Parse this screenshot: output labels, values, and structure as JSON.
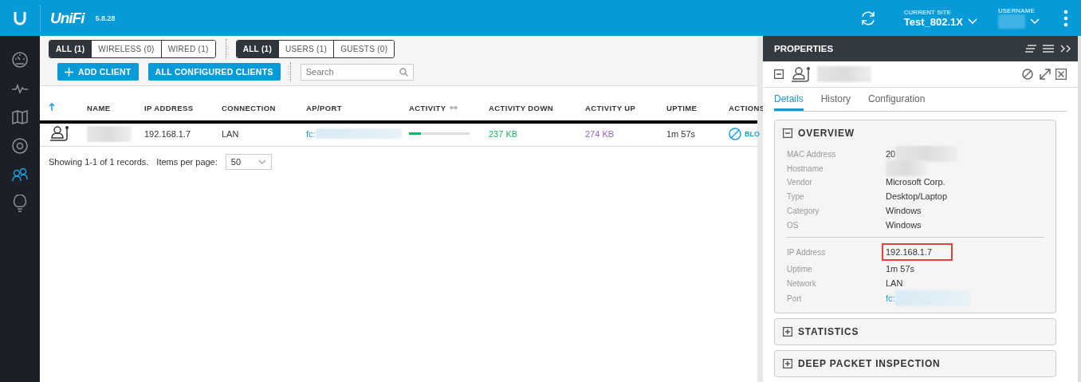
{
  "header": {
    "logo_text": "UniFi",
    "version": "5.8.28",
    "site_label": "CURRENT SITE",
    "site": "Test_802.1X",
    "user_label": "USERNAME"
  },
  "sidebar": {
    "items": [
      {
        "kind": "dashboard",
        "selected": false
      },
      {
        "kind": "statistics",
        "selected": false
      },
      {
        "kind": "map",
        "selected": false
      },
      {
        "kind": "devices",
        "selected": false
      },
      {
        "kind": "clients",
        "selected": true
      },
      {
        "kind": "insights",
        "selected": false
      }
    ]
  },
  "filters": {
    "connection": [
      {
        "label": "ALL (1)",
        "selected": true
      },
      {
        "label": "WIRELESS (0)",
        "selected": false
      },
      {
        "label": "WIRED (1)",
        "selected": false
      }
    ],
    "type": [
      {
        "label": "ALL (1)",
        "selected": true
      },
      {
        "label": "USERS (1)",
        "selected": false
      },
      {
        "label": "GUESTS (0)",
        "selected": false
      }
    ]
  },
  "buttons": [
    {
      "label": "ADD CLIENT",
      "kind": "add"
    },
    {
      "label": "ALL CONFIGURED CLIENTS",
      "kind": "plain"
    }
  ],
  "search": {
    "placeholder": "Search"
  },
  "table": {
    "columns": [
      "NAME",
      "IP ADDRESS",
      "CONNECTION",
      "AP/PORT",
      "ACTIVITY",
      "ACTIVITY DOWN",
      "ACTIVITY UP",
      "UPTIME",
      "ACTIONS"
    ],
    "rows": [
      {
        "ip": "192.168.1.7",
        "connection": "LAN",
        "ap_port": "fc:",
        "level": 0.2,
        "down": "237 KB",
        "up": "274 KB",
        "uptime": "1m 57s",
        "action": "BLO"
      }
    ]
  },
  "pager": {
    "summary": "Showing 1-1 of 1 records.",
    "per_page_label": "Items per page:",
    "per_page": "50"
  },
  "properties": {
    "title": "PROPERTIES",
    "tabs": [
      {
        "label": "Details",
        "selected": true
      },
      {
        "label": "History",
        "selected": false
      },
      {
        "label": "Configuration",
        "selected": false
      }
    ],
    "sections": [
      {
        "title": "OVERVIEW",
        "expanded": true,
        "groups": [
          [
            {
              "label": "MAC Address",
              "value": "20",
              "kind": "text",
              "blurred": true,
              "highlighted": false
            },
            {
              "label": "Hostname",
              "kind": "text",
              "blurred": true,
              "highlighted": false
            },
            {
              "label": "Vendor",
              "value": "Microsoft Corp.",
              "kind": "text",
              "blurred": false,
              "highlighted": false
            },
            {
              "label": "Type",
              "value": "Desktop/Laptop",
              "kind": "text",
              "blurred": false,
              "highlighted": false
            },
            {
              "label": "Category",
              "value": "Windows",
              "kind": "text",
              "blurred": false,
              "highlighted": false
            },
            {
              "label": "OS",
              "value": "Windows",
              "kind": "text",
              "blurred": false,
              "highlighted": false
            }
          ],
          [
            {
              "label": "IP Address",
              "value": "192.168.1.7",
              "kind": "text",
              "blurred": false,
              "highlighted": true
            },
            {
              "label": "Uptime",
              "value": "1m 57s",
              "kind": "text",
              "blurred": false,
              "highlighted": false
            },
            {
              "label": "Network",
              "value": "LAN",
              "kind": "text",
              "blurred": false,
              "highlighted": false
            },
            {
              "label": "Port",
              "value": "fc:",
              "kind": "link",
              "blurred": true,
              "highlighted": false
            }
          ]
        ]
      },
      {
        "title": "STATISTICS",
        "expanded": false
      },
      {
        "title": "DEEP PACKET INSPECTION",
        "expanded": false
      }
    ]
  }
}
